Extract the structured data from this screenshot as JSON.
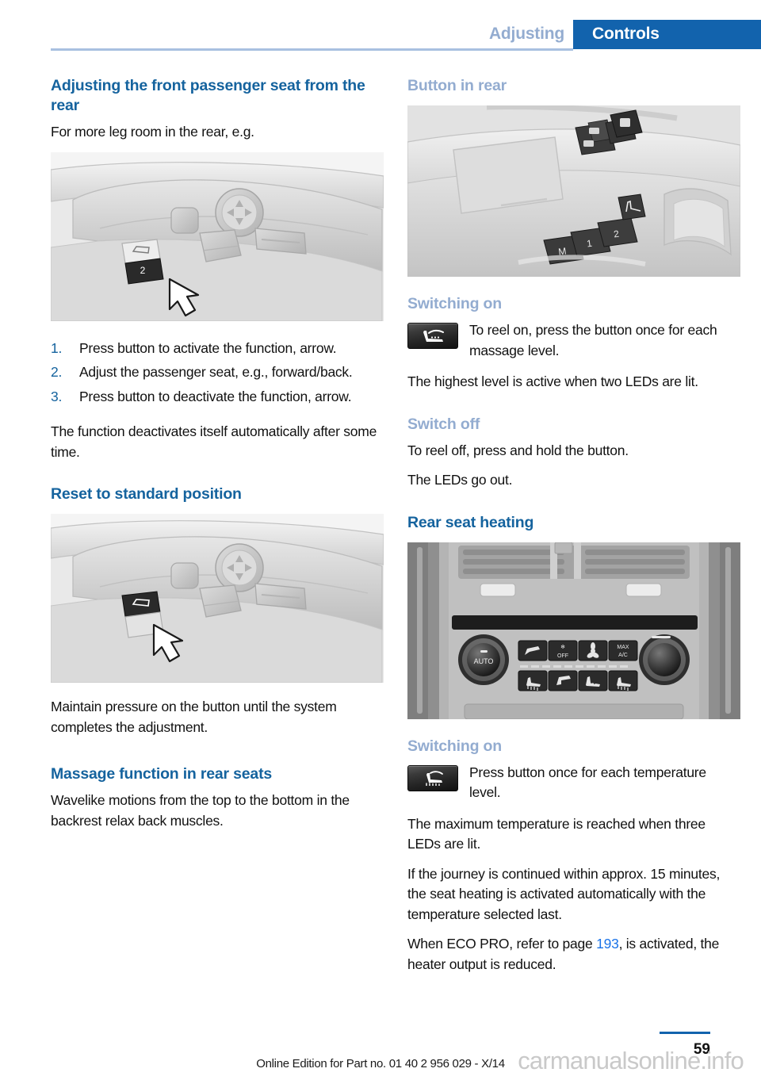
{
  "header": {
    "chapter": "Adjusting",
    "section": "Controls"
  },
  "left_column": {
    "heading_1": "Adjusting the front passenger seat from the rear",
    "intro": "For more leg room in the rear, e.g.",
    "figure_1_name": "seat-side-controls-button-2",
    "steps": [
      {
        "num": "1.",
        "text": "Press button to activate the function, arrow."
      },
      {
        "num": "2.",
        "text": "Adjust the passenger seat, e.g., forward/back."
      },
      {
        "num": "3.",
        "text": "Press button to deactivate the function, arrow."
      }
    ],
    "after_steps": "The function deactivates itself automatically after some time.",
    "heading_2": "Reset to standard position",
    "figure_2_name": "seat-side-controls-reset-button",
    "reset_text": "Maintain pressure on the button until the system completes the adjustment.",
    "heading_3": "Massage function in rear seats",
    "massage_text": "Wavelike motions from the top to the bottom in the backrest relax back muscles."
  },
  "right_column": {
    "subheading_1": "Button in rear",
    "figure_3_name": "rear-door-panel-memory-buttons",
    "subheading_2": "Switching on",
    "massage_button_caption": "To reel on, press the button once for each massage level.",
    "massage_note": "The highest level is active when two LEDs are lit.",
    "subheading_3": "Switch off",
    "switch_off_line_1": "To reel off, press and hold the button.",
    "switch_off_line_2": "The LEDs go out.",
    "heading_rear_seat_heating": "Rear seat heating",
    "figure_4_name": "rear-climate-control-panel",
    "subheading_4": "Switching on",
    "heating_button_caption": "Press button once for each temperature level.",
    "heating_note_1": "The maximum temperature is reached when three LEDs are lit.",
    "heating_note_2": "If the journey is continued within approx. 15 minutes, the seat heating is activated automatically with the temperature selected last.",
    "heating_note_3_before": "When ECO PRO, refer to page ",
    "heating_note_3_link": "193",
    "heating_note_3_after": ", is activated, the heater output is reduced."
  },
  "figures": {
    "door_buttons": [
      "M",
      "1",
      "2"
    ]
  },
  "icons": {
    "massage_button": "seat-massage-icon",
    "seat_heating_button": "seat-heating-icon"
  },
  "footer": {
    "edition": "Online Edition for Part no. 01 40 2 956 029 - X/14",
    "page_number": "59",
    "watermark": "carmanualsonline.info"
  },
  "colors": {
    "heading_blue": "#15639E",
    "subheading_blue": "#93ACD0",
    "tab_blue": "#1263AD",
    "link_blue": "#1A73E8"
  }
}
